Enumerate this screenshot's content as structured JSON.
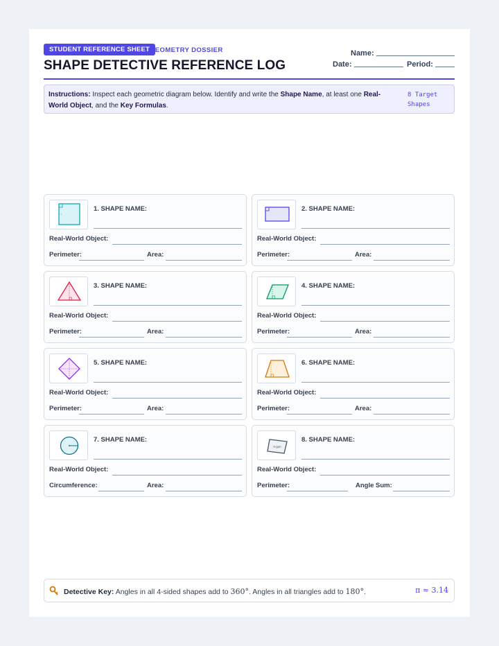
{
  "header": {
    "badge": "STUDENT REFERENCE SHEET",
    "subtitle": "GEOMETRY DOSSIER",
    "title": "SHAPE DETECTIVE REFERENCE LOG",
    "name_label": "Name:",
    "date_label": "Date:",
    "period_label": "Period:"
  },
  "instructions": {
    "label": "Instructions:",
    "text1": " Inspect each geometric diagram below. Identify and write the ",
    "bold1": "Shape Name",
    "text2": ", at least one ",
    "bold2": "Real-World Object",
    "text3": ", and the ",
    "bold3": "Key Formulas",
    "text4": ".",
    "target": "8 Target Shapes"
  },
  "colors": {
    "accent": "#4f46e5",
    "square": "#0ea5b7",
    "rectangle": "#4f46e5",
    "triangle": "#e11d48",
    "parallelogram": "#059669",
    "rhombus": "#9333ea",
    "trapezoid": "#d97706",
    "circle": "#0e7490",
    "ngon": "#475569"
  },
  "cards": [
    {
      "shape_label": "1. SHAPE NAME:",
      "icon": "square-icon",
      "object_label": "Real-World Object:",
      "f1_label": "Perimeter:",
      "f2_label": "Area:"
    },
    {
      "shape_label": "2. SHAPE NAME:",
      "icon": "rectangle-icon",
      "object_label": "Real-World Object:",
      "f1_label": "Perimeter:",
      "f2_label": "Area:"
    },
    {
      "shape_label": "3. SHAPE NAME:",
      "icon": "triangle-icon",
      "object_label": "Real-World Object:",
      "f1_label": "Perimeter:",
      "f2_label": "Area:"
    },
    {
      "shape_label": "4. SHAPE NAME:",
      "icon": "parallelogram-icon",
      "object_label": "Real-World Object:",
      "f1_label": "Perimeter:",
      "f2_label": "Area:"
    },
    {
      "shape_label": "5. SHAPE NAME:",
      "icon": "rhombus-icon",
      "object_label": "Real-World Object:",
      "f1_label": "Perimeter:",
      "f2_label": "Area:"
    },
    {
      "shape_label": "6. SHAPE NAME:",
      "icon": "trapezoid-icon",
      "object_label": "Real-World Object:",
      "f1_label": "Perimeter:",
      "f2_label": "Area:"
    },
    {
      "shape_label": "7. SHAPE NAME:",
      "icon": "circle-icon",
      "object_label": "Real-World Object:",
      "f1_label": "Circumference:",
      "f2_label": "Area:"
    },
    {
      "shape_label": "8. SHAPE NAME:",
      "icon": "ngon-icon",
      "icon_text": "4-gon",
      "object_label": "Real-World Object:",
      "f1_label": "Perimeter:",
      "f2_label": "Angle Sum:"
    }
  ],
  "footer": {
    "key_label": "Detective Key:",
    "key_text1": " Angles in all 4-sided shapes add to ",
    "angle1": "360°",
    "key_text2": ". Angles in all triangles add to ",
    "angle2": "180°",
    "key_text3": ".",
    "pi": "π ≈ 3.14"
  }
}
